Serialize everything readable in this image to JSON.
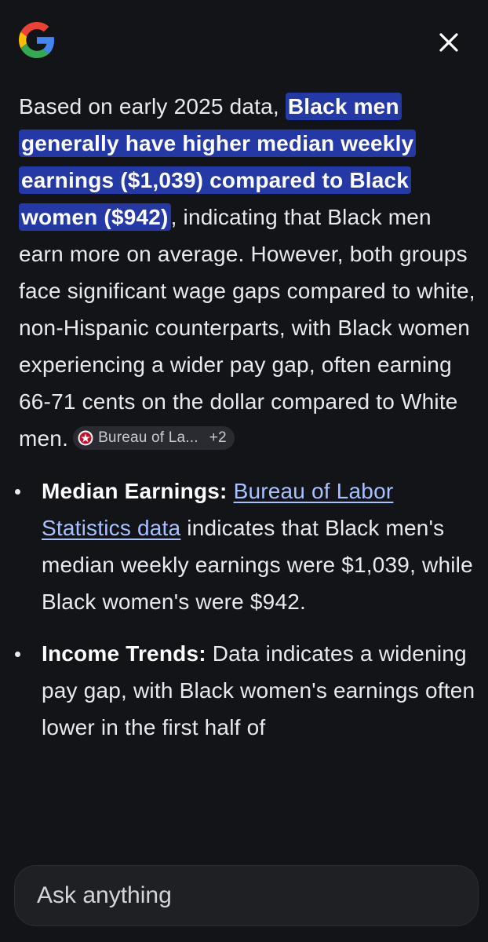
{
  "header": {
    "logo_icon": "google-g-icon",
    "close_icon": "close-icon",
    "logo_colors": {
      "blue": "#4285F4",
      "red": "#EA4335",
      "yellow": "#FBBC05",
      "green": "#34A853"
    }
  },
  "answer": {
    "intro_lead": "Based on early 2025 data, ",
    "intro_highlight": "Black men generally have higher median weekly earnings ($1,039) compared to Black women ($942)",
    "intro_rest": ", indicating that Black men earn more on average. However, both groups face significant wage gaps compared to white, non-Hispanic counterparts, with Black women experiencing a wider pay gap, often earning 66-71 cents on the dollar compared to White men.",
    "source_chip": {
      "label": "Bureau of La...",
      "more": "+2",
      "icon": "bls-logo-icon"
    },
    "highlight_color": "#2438a6",
    "link_color": "#a8c1ff",
    "bullets": [
      {
        "title": "Median Earnings:",
        "link": "Bureau of Labor Statistics data",
        "text": " indicates that Black men's median weekly earnings were $1,039, while Black women's were $942."
      },
      {
        "title": "Income Trends:",
        "text": " Data indicates a widening pay gap, with Black women's earnings often lower in the first half of"
      }
    ]
  },
  "composer": {
    "placeholder": "Ask anything"
  }
}
